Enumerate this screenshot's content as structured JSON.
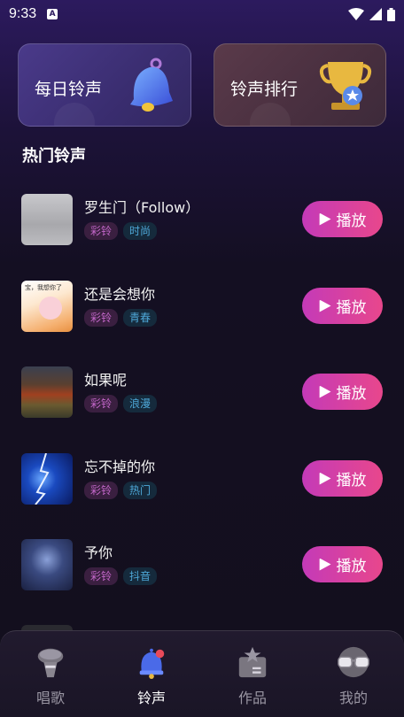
{
  "status": {
    "time": "9:33"
  },
  "cards": {
    "daily": {
      "label": "每日铃声"
    },
    "rank": {
      "label": "铃声排行"
    }
  },
  "section": {
    "title": "热门铃声"
  },
  "play_label": "播放",
  "songs": [
    {
      "title": "罗生门（Follow）",
      "tags": [
        "彩铃",
        "时尚"
      ]
    },
    {
      "title": "还是会想你",
      "tags": [
        "彩铃",
        "青春"
      ],
      "cover_text": "宝，我想你了"
    },
    {
      "title": "如果呢",
      "tags": [
        "彩铃",
        "浪漫"
      ]
    },
    {
      "title": "忘不掉的你",
      "tags": [
        "彩铃",
        "热门"
      ]
    },
    {
      "title": "予你",
      "tags": [
        "彩铃",
        "抖音"
      ]
    }
  ],
  "nav": {
    "items": [
      {
        "label": "唱歌",
        "icon": "microphone-icon"
      },
      {
        "label": "铃声",
        "icon": "bell-icon",
        "active": true
      },
      {
        "label": "作品",
        "icon": "works-icon"
      },
      {
        "label": "我的",
        "icon": "glasses-icon"
      }
    ]
  },
  "colors": {
    "accent_start": "#c43ab8",
    "accent_end": "#e8478c",
    "tag_pink": "#c266c8",
    "tag_blue": "#4ea8d8"
  }
}
